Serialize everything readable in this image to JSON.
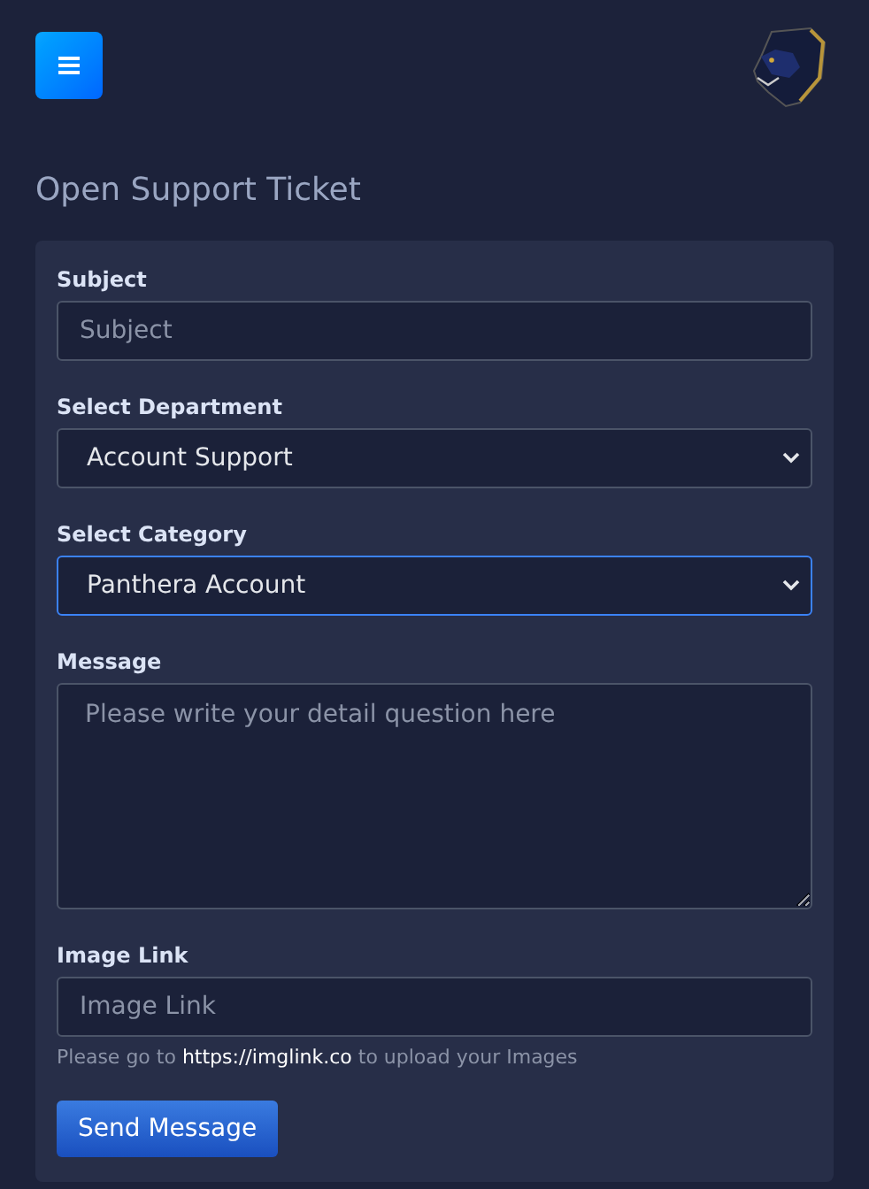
{
  "page": {
    "title": "Open Support Ticket"
  },
  "form": {
    "fields": [
      {
        "kind": "text",
        "label": "Subject",
        "placeholder": "Subject",
        "focused": false
      },
      {
        "kind": "select",
        "label": "Select Department",
        "value": "Account Support",
        "focused": false
      },
      {
        "kind": "select",
        "label": "Select Category",
        "value": "Panthera Account",
        "focused": true
      },
      {
        "kind": "textarea",
        "label": "Message",
        "placeholder": "Please write your detail question here",
        "focused": false
      },
      {
        "kind": "text",
        "label": "Image Link",
        "placeholder": "Image Link",
        "focused": false,
        "help": {
          "before": "Please go to",
          "link": "https://imglink.co",
          "after": "to upload your Images"
        }
      }
    ],
    "submit": "Send Message"
  }
}
